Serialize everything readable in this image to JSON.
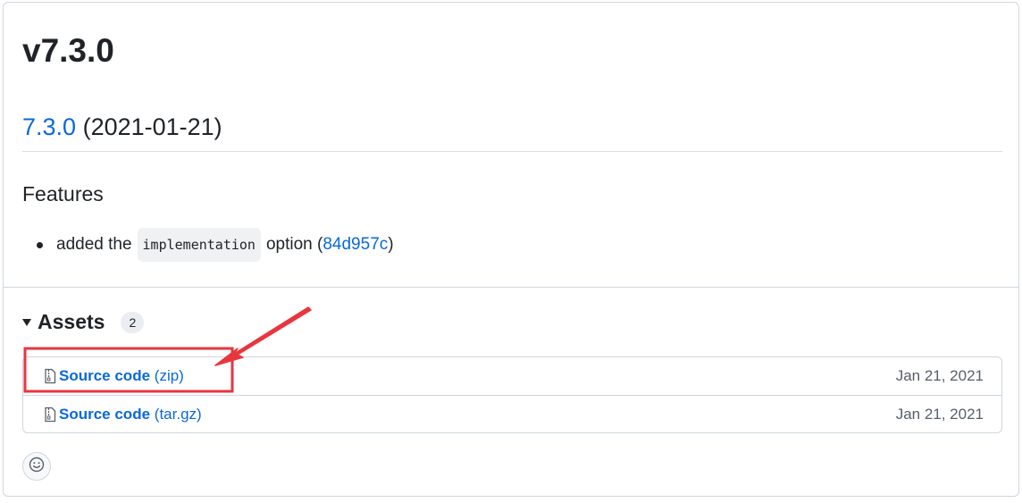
{
  "release": {
    "title": "v7.3.0",
    "version_link": "7.3.0",
    "version_date": "(2021-01-21)",
    "section_heading": "Features",
    "features": [
      {
        "prefix": "added the",
        "code": "implementation",
        "suffix": "option",
        "open_paren": "(",
        "commit": "84d957c",
        "close_paren": ")"
      }
    ]
  },
  "assets": {
    "heading": "Assets",
    "count": "2",
    "items": [
      {
        "name": "Source code",
        "ext": "(zip)",
        "date": "Jan 21, 2021",
        "icon": "file-zip-icon"
      },
      {
        "name": "Source code",
        "ext": "(tar.gz)",
        "date": "Jan 21, 2021",
        "icon": "file-zip-icon"
      }
    ]
  },
  "reactions": {
    "icon": "smiley-icon"
  },
  "annotation": {
    "highlight_color": "#e8363f"
  }
}
